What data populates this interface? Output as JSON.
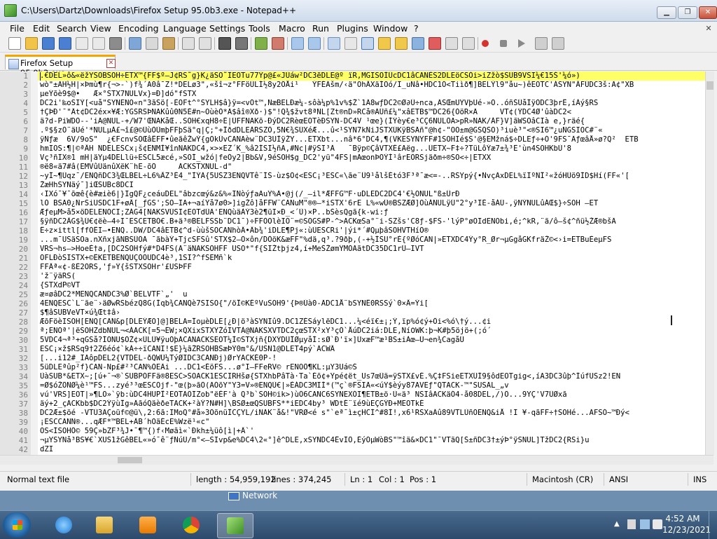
{
  "window": {
    "title": "C:\\Users\\Dartz\\Downloads\\Firefox Setup 95.0b3.exe - Notepad++"
  },
  "menu": {
    "items": [
      "File",
      "Edit",
      "Search",
      "View",
      "Encoding",
      "Language",
      "Settings",
      "Tools",
      "Macro",
      "Run",
      "Plugins",
      "Window",
      "?"
    ]
  },
  "tab": {
    "label": "Firefox Setup 95.0b3.exe"
  },
  "editor": {
    "line_numbers": [
      "1",
      "2",
      "3",
      "4",
      "5",
      "6",
      "7",
      "8",
      "9",
      "10",
      "11",
      "12",
      "13",
      "14",
      "15",
      "16",
      "17",
      "18",
      "19",
      "20",
      "21",
      "22",
      "23",
      "24",
      "25",
      "26",
      "27",
      "28",
      "29",
      "30",
      "31",
      "32",
      "33",
      "34",
      "35",
      "36",
      "37",
      "38",
      "39",
      "40",
      "41",
      "42"
    ],
    "lines": [
      ".€DEL»ô&«ëžYSOBSOH÷ETX™{FF$º—J¢RS˜g}K¿äSO˜ÏEOTu77Ÿp@£«JÙáw²DC3ẽDLE@º ïR,MGISOÍÜcDC1âCANÈS2DLEöCSÒi>iZžò$SUB9VSI¼€15Š'¼ó»)",
      "wò\"±AH½H|×Þmù¶r{¬>-`)f¾´A0â¯Z!*DELø3\",«šî¬z°FFöÜLÍ½8y2ÔÅi¹   ÝFÉÄšm/‹ä\"OhÂXäÍÕó/Ï_uNâ•HDC1Ó<Tiìð¶]BELÝl9\"åu~)êEOTC'ÁSYN\"ÂFÚDC3š:Ä¢\"XB",
      "µeÝõè9$@•   Æ×°STX7NULVx}=Ð]dó\"fSTX",
      "DC2i'‰oSIÝ[<uå\"SYNENO«n\"3ãSö[-ÈÕFt^°SYLH$â}ÿ=<vÓt™,ÑæBELÐæ¼-sôà¼p%1v%$Ž`1Ä8wƒDC2©Ø∂Ú÷nca,ÄSŒmUŸVþUé-»Ö..óñŠÚåÍÿÓDC3þrÊ,íÁý§RS",
      "†ÇÞÐ'¯\"Ât¢DC2éx×¥Æ:YGSRSÞNAKûû0N5É#n~ÕùèÒ*Ä$âî®Xð·)$\"!Q¾$žvt8ªÑL[Zt®nD»RCå®ÄÛñ£¼\"xâETB$™DC26{ÒöR×Ä     VT¢(ÝDC4Ø'ûàDC2<",
      "ä?d-PiWDÖ--'iÄ@NUL-+/W7'ŒNAKåŒ..SOH€xqH8÷É|ÜFFNAKõ-ÐýDC2RèœEOTèÐSYN-DC4V ¹œe}(ÍÝèy€e³CÇ6NULÖA>pR»NAK/ÁF}V]ãWSOâCIà e,}räé{",
      ".º$§zÓ¨äUé'*NULµÁ£¬î£@©ÜùÒÙmþFFþSä°q|Ç;°+ÎðdDLEÀRSZÔ,5N€¾SÚXéÆ...û<¹SYN7kÑiJSTXÚKÿBSÄñ\"@h¢-\"OO±m@GSQSO)³iuè³\"<®SI6™¿uÑGSIOC#¨«",
      "ÿÑƒæ  6V/9oS\"  ¿€FcnvSOŒâÊFF•ûeãêŽwÝ{gOkÙvCANAèw¨DC3UÌÿŽY...ETXbt...nâ*6°DC4,¶(VKESYNYFF#1SOHIé$S'@§EMžná$÷DLEƒ÷+Ó'9FS¯ÄƒœâÅ»ø?Q²  ETB",
      "hmIOS:¶|©ªÂH ÑDELESCx¡š¢ENMÌ¥înNAKDC4,×>×EZ´K_%â2ÍSI½ñÃ,#Nc|#ÿSI³Ä   ¯Bÿp©ÇâVTXÉ£Aëg...ÜETX~F‡÷?TüLôÝæ7±¾³Ë'ùn4SOHKbÙ'8",
      "Vç³ñÏX®1 mH|äYµ4DELlü÷ESCL5æcé,»SOÍ_wžó|feÓy2|Bb&V,9éSOH$g_DC2'yü\"4FS|mÃœonÞÕÝÍ¹ârEÖRSjäðm÷®SO<÷|ETXX",
      "®ë8«ä7#â(EMVûÜänûXëK¨hË-õÖ     ACKSTXNUL-d\"",
      "~yÍ~¶Ùqz¯/ENQñDC3¾ŒLBEL÷L6%ÂZ³É4_\"ÌÝÄ{5UŠZ3ENQVTê¨ÍŠ-ùz$Ö¢<ESC¡³ESC«\\ãe¨Û9¹ålšÉtó3F³ª¯æ<=-..RSYpý{•ÑvçÃxDEL%ïÏºÑÎ²«žóHÙö9ÍD$Hí(FF«'[",
      "ŽæHhSYNäý¯]iŒSUBc8DCI",
      "‹ÏXó¯¥¯õœê{è#æiè6|}ÏgQF¿ceáuDEL\"âbzcœý&z&%«ÏÑòýƒaAuŸ%Ä•@j(/_—il*ÆFFG™F·uDLEDC2DC4'€½ONUL\"ß±ÛrÐ",
      "lÒ BSA0¿ÑrSiUSDC1F+øÂ[_ƒGS';SO—ÏA+¬aíŸå7ø0>]igŽô]åFFW¨CANuM\"®®–*iSTX'6rE L%«wÚ®BSZÆØ]OùÁNULÿÚ\"2°y³ÏÉ-åÁÚ-,ÿNÝNULûÁŒ$}÷SOH –ET",
      "ÆƒeµM>å5×öDELENOCI;ZÁG4[NAKSVÚSI¢EOTdÜÄ'ENQùäÀÝ3è2¶üI×Ð_<´Ù)×P..bŠèsQgã{k-wi:ƒ",
      "§ÿñDC2ÂG$¾Ú€¢ëè—4÷I¯ESCETBÓ€.B+ä³®BELFSSb¨DC1¯)÷FFÒOlèIÓ¨=©SOGS#P-^>ACKœŠa°¨i-SZšs'C8ƒ-$FS-'lýP°øOIdENObi,é;^kR,¨ã/ô–š¢^ñü½ŽÆ®bšÄ",
      "Ê÷z×ittl[ffÕÊI–•ENQ..DW/DC4âETB¢^d-ùùšSOCANhòÂ•Âb¾'iDLE¶Pj«:ùÜESCRi'|ýi*´#QµþâSOHVTHíÕ®",
      "...m¯USäSOa.nXñxjäNBSÙÖÄ ¯ãbàÝ+TjcSFSû'STX$2—Ö×ôn/DÖöK&æFF\"%dä,q³.?9ðþ,(-+½ÍSU°rÉ{ºØóCAN|»ETXDC4Ýy°R_Ør¬µGgåGKfräŽ©<›i=ETBuÈeµFS",
      "VRS¬hs—>HoeÈ†a,[DC2SOHfý#*D4FS(A¨äNAKSOHFF USO*\"f{SIŽtþjz4,í+MeŠŽømŸMÖÃãtDC35DC1rÜ—IVT",
      "ÓFLÐòSISTX+©ÊKETBENQUÇÒÔUDC4è³,1SI?^fSEMñ`k",
      "FFÂª«¢-ßÈ2ÖRS,'ƒ»Ý{šSTXSOHr'£USÞFF",
      "'ž¨ÿäRS(",
      "{STXdP©VT",
      "æ¤øâDC2*MENQCANDC3%Ø`BELVTF`„'  u",
      "4ENQESC`L¨ãe¨›äØwRSbézQ8G(Íqb¾CANQè7SISO{\"/öÎ©KÉºVuSOH9'{Þ®Ùà0-ÄDC1Å¨bSYNÊ0RSSý`0×Â=Ýi[",
      "$¶âSUBVeVT×ú¾Œt‡â›",
      "ÆõFöèISOH[ENQ[CAN&p[DLEÝÆÕ]@]BELA=ÎoµèDLE[¿Ð|ö³àSYNIû9.DC1ZÈSáylëDC1...¼<éï€±¡;Ý,ïp%ó¢ý+Ôi<%ó\\†ý...¢i",
      "ª;ENOª'|ëSOHZdbNUL¬<ÁACK[=5¬ÊW;×QXixSTXŸŽóIVTÀ@NAKSXVTDC2çœSTX²xY³çÔ`ÅúDC2iá:DLE,Ñí߀WK:þ¬K#þ5öjö+(;ó´",
      "5VDC4¬ª³+qGSå?ÍONU$ÖŽ¢×ÛLÛ¥ÿuÓþÁCANACKSEOT¼Ì©STXjñ{DXÝDÛÎØµyåÍ:sØ`Ð'ï×]ÚxæF™æ¹BS±iÀœ—Ù¬en¾CagåÛ",
      "ESC¡×ž$RSq9†2Z6éó¢`kÁ÷÷ïCANI!$E}¼ãŽRSOHBSæÞÝ0m°&/USN1@DLET4pý`ÄCWÂ",
      "[...i12#_ÏÃôpDEL2{VTDEL-ðQWÜ¼TýØIDC3CANÐj)ØrYACKÈ0P-!",
      "5üDLEªûp²f}CAN-Np£#²³CAN%ÒEÄi ...DC1<ÉöFS...ø°I—FFeRV© rENOÔ¶KL:µY3Uá©Š",
      "ÙàSUB*&ETX~;[ú+¯¬®`SUBPÓFFä®8ESC>SOACK1ESCIRHšø{STXhbPâTà·Ta`Éõ¢+Ÿpé¢ët_Us7œÙä=ÿSTX£vÈ.%Ç‡FSieETXÜÍ9§ôdEOTgig<,íA3DC3ûþ^ÍúfUSz2!EN",
      "=Ø$óŽÔÑØ¼è¹™FS...zyé³³œESCÕjf-\"œ(þ»ãÖ(ÃÓõY\"Y3=V»®ENQÙ€|»ÈÁDC3MIÍ*(™ç`®FSIÄ«<úŸ$èýy87AVEƒ\"QTACK-™\"SUSÃL_„v",
      "vú'VRS]EOT|»¶LÕ»`ÿb:ùDC4HUPÎ²EOTÃÖÏZob\"ëÈF'à Q³b`SOH©ik>)ùÖ6CANC6SYNEXÓI¶ETB±ö·Ù«ä³ NSIâACKäÓ4-å08DEL,/)Ö...9YÇ'V7ÜØxã",
      "äý+2_çACKbb$DC2ÝÿùÎg»ÄãóQäèðeTACK+²àÝ?N#H]\\BSØ±œQSUBFS**iEDC4by³ WDtÉ¨ïé9ùEÇGÝÐ+MEOTkÈ",
      "DC2Æ±$öé -VTÙ3ÃÇoüf©@ü\\,2:6ã:IMoQ°#å»3ÖõnüÎCÇYL/iNAK¨å&!\"VRØ<é s\"`eª¯ì±çHCÍ^#8Ì!,x6¹RSXaÄû89VTLÙñÕENQ&iÅ !Ï ¥-qãFF÷†SOHé...ÃFSÓ~™Ðý<",
      "¡ESCCANN®...qÆF*™BEL+ÀB´hÕäÉcE%Wzë¹«c\"",
      "ÕS<ÍSOHÔ© 59Ç»bZF³¾J•¯¶™{)f‹Møãì«`Ðkh±¼üô[ì|+Â`'",
      "¬µYSYNå³BS¥€`XUS1žGêBEL«»ó¯ê¨ƒNúÜ/m°<—SIvp&e%DC4\\2«°]ê^DLE,xSYNDC4ÊvÏÔ,ÉýÕµWòBS\"™îä&×DC1\"¯VTãQ[Š±ñDC3†±ýÞ°ÿSNUL]TžDC2{RSi}u",
      "dZI"
    ]
  },
  "status": {
    "file_type": "Normal text file",
    "length": "length : 54,959,192",
    "lines": "lines : 374,245",
    "ln": "Ln : 1",
    "col": "Col : 1",
    "pos": "Pos : 1",
    "eol": "Macintosh (CR)",
    "encoding": "ANSI",
    "mode": "INS"
  },
  "desktop": {
    "network_label": "Network"
  },
  "taskbar": {
    "time": "4:52 AM",
    "date": "12/23/2021"
  },
  "colors": {
    "current_line": "#ffff66",
    "active_tab_accent": "#f6a500",
    "gutter": "#e4e4e4"
  }
}
